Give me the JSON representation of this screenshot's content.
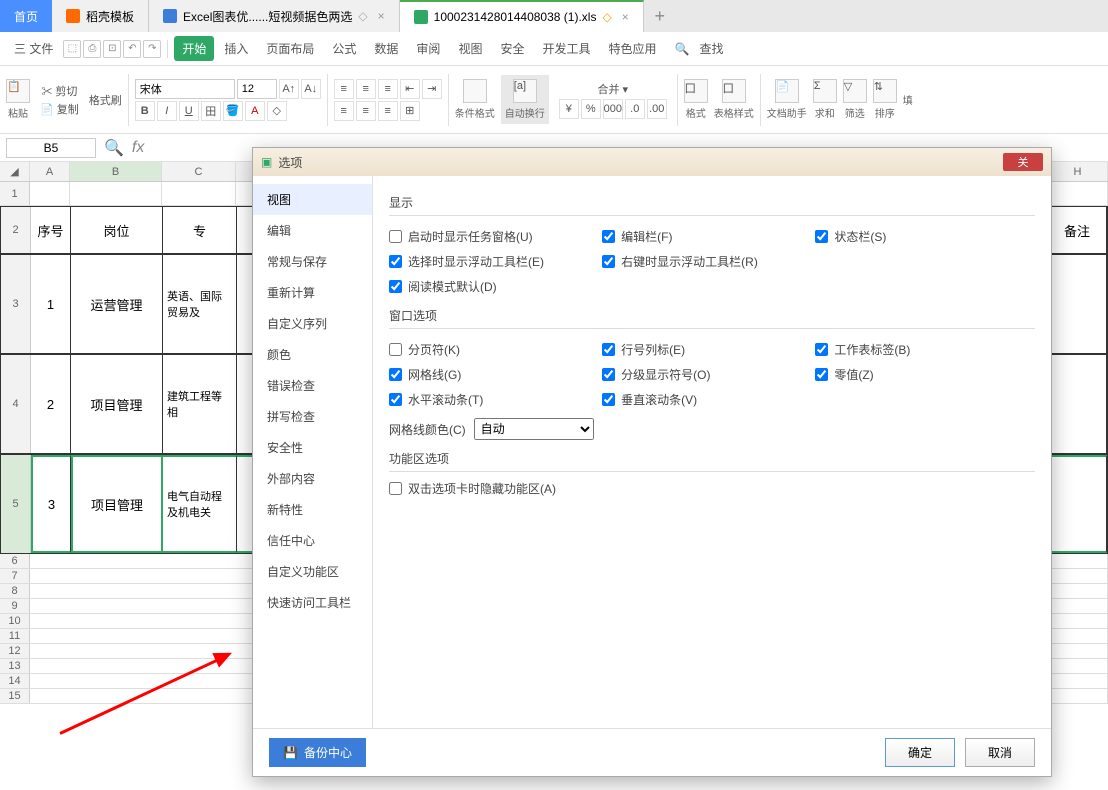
{
  "tabs": {
    "home": "首页",
    "t1": "稻壳模板",
    "t2": "Excel图表优......短视频据色两选",
    "t3": "1000231428014408038 (1).xls"
  },
  "menu": {
    "file": "三 文件",
    "start": "开始",
    "insert": "插入",
    "layout": "页面布局",
    "formula": "公式",
    "data": "数据",
    "review": "审阅",
    "view": "视图",
    "security": "安全",
    "dev": "开发工具",
    "special": "特色应用",
    "search_ph": "查找"
  },
  "ribbon": {
    "paste": "粘贴",
    "cut": "剪切",
    "copy": "复制",
    "format_painter": "格式刷",
    "font": "宋体",
    "size": "12",
    "conditional": "条件格式",
    "auto_wrap": "自动换行",
    "merge": "合并",
    "cell_fmt": "格式",
    "cell_style": "表格样式",
    "text_rotate": "文档助手",
    "sum": "求和",
    "filter": "筛选",
    "sort": "排序",
    "fill": "填"
  },
  "namebox": "B5",
  "grid": {
    "cols": [
      "A",
      "B",
      "C",
      "",
      "H"
    ],
    "hdr1": "序号",
    "hdr2": "岗位",
    "hdr3": "专",
    "hdr_last": "备注",
    "r1_a": "1",
    "r1_b": "运营管理",
    "r1_c": "英语、国际贸易及",
    "r2_a": "2",
    "r2_b": "项目管理",
    "r2_c": "建筑工程等相",
    "r3_a": "3",
    "r3_b": "项目管理",
    "r3_c": "电气自动程及机电关"
  },
  "dialog": {
    "title": "选项",
    "close": "关",
    "side": [
      "视图",
      "编辑",
      "常规与保存",
      "重新计算",
      "自定义序列",
      "颜色",
      "错误检查",
      "拼写检查",
      "安全性",
      "外部内容",
      "新特性",
      "信任中心",
      "自定义功能区",
      "快速访问工具栏"
    ],
    "side_active": 0,
    "sec1": "显示",
    "o1": "启动时显示任务窗格(U)",
    "o2": "编辑栏(F)",
    "o3": "状态栏(S)",
    "o4": "选择时显示浮动工具栏(E)",
    "o5": "右键时显示浮动工具栏(R)",
    "o6": "阅读模式默认(D)",
    "sec2": "窗口选项",
    "w1": "分页符(K)",
    "w2": "行号列标(E)",
    "w3": "工作表标签(B)",
    "w4": "网格线(G)",
    "w5": "分级显示符号(O)",
    "w6": "零值(Z)",
    "w7": "水平滚动条(T)",
    "w8": "垂直滚动条(V)",
    "combo_label": "网格线颜色(C)",
    "combo_val": "自动",
    "sec3": "功能区选项",
    "f1": "双击选项卡时隐藏功能区(A)",
    "backup": "备份中心",
    "ok": "确定",
    "cancel": "取消"
  }
}
